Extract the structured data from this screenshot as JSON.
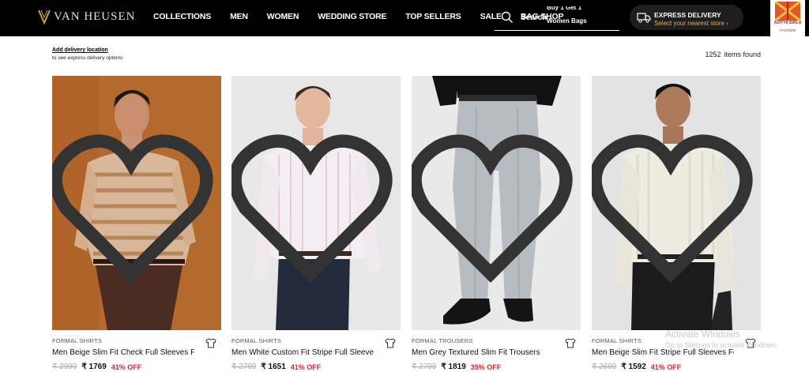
{
  "header": {
    "brand": "VAN HEUSEN",
    "nav": [
      "COLLECTIONS",
      "MEN",
      "WOMEN",
      "WEDDING STORE",
      "TOP SELLERS",
      "SALE",
      "BAG SHOP"
    ],
    "search": {
      "label": "Search",
      "promos": [
        "Buy 1 Get 1",
        "Women Bags"
      ],
      "icon": "search-icon"
    },
    "delivery": {
      "title": "EXPRESS DELIVERY",
      "subtitle": "Select your nearest store ›",
      "icon": "truck-icon"
    },
    "partner": {
      "name": "ADITYA BIRLA",
      "sub": "FASHION"
    }
  },
  "subbar": {
    "delivery_link": "Add delivery location",
    "delivery_note": "to see express delivery options",
    "count_value": "1252",
    "count_label": "items found"
  },
  "products": [
    {
      "category": "FORMAL SHIRTS",
      "title": "Men Beige Slim Fit Check Full Sleeves Formal S...",
      "mrp": "₹ 2999",
      "price": "₹ 1769",
      "discount": "41% OFF",
      "bg": "#b0642a"
    },
    {
      "category": "FORMAL SHIRTS",
      "title": "Men White Custom Fit Stripe Full Sleeves Form...",
      "mrp": "₹ 2799",
      "price": "₹ 1651",
      "discount": "41% OFF",
      "bg": "#e7e7e7"
    },
    {
      "category": "FORMAL TROUSERS",
      "title": "Men Grey Textured Slim Fit Trousers",
      "mrp": "₹ 2799",
      "price": "₹ 1819",
      "discount": "35% OFF",
      "bg": "#e9e9e9"
    },
    {
      "category": "FORMAL SHIRTS",
      "title": "Men Beige Slim Fit Stripe Full Sleeves Formal S...",
      "mrp": "₹ 2699",
      "price": "₹ 1592",
      "discount": "41% OFF",
      "bg": "#e3e3e3"
    }
  ],
  "watermark": {
    "title": "Activate Windows",
    "subtitle": "Go to Settings to activate Windows."
  },
  "colors": {
    "header_bg": "#000000",
    "discount": "#d0262c",
    "delivery_accent": "#e0b24a"
  }
}
